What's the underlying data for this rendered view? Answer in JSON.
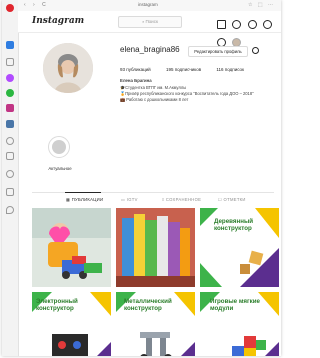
{
  "browser": {
    "nav_glyphs": "‹ › C",
    "url": "instagram",
    "actions_glyphs": "☆ ⬚ ⋯"
  },
  "header": {
    "logo": "Instagram",
    "search_placeholder": "Поиск"
  },
  "profile": {
    "username": "elena_bragina86",
    "edit_button": "Редактировать профиль",
    "stats": {
      "posts": "93 публикаций",
      "followers": "195 подписчиков",
      "following": "116 подписок"
    },
    "full_name": "Елена Брагина",
    "bio_lines": [
      "🎓Студентка ВТПГ им. М.Акмуллы",
      "🏅Призёр республиканского конкурса \"Воспитатель года ДОО – 2018\"",
      "💼 Работаю с дошкольниками 8 лет"
    ]
  },
  "highlights": [
    {
      "label": "Актуальное"
    }
  ],
  "tabs": {
    "posts": "ПУБЛИКАЦИИ",
    "igtv": "IGTV",
    "saved": "СОХРАНЕННОЕ",
    "tagged": "ОТМЕТКИ"
  },
  "tiles": [
    {
      "label": ""
    },
    {
      "label": ""
    },
    {
      "label": "Деревянный конструктор"
    },
    {
      "label": "Электронный конструктор"
    },
    {
      "label": "Металлический конструктор"
    },
    {
      "label": "Игровые мягкие модули"
    }
  ],
  "colors": {
    "accent_green": "#2a7d2a",
    "accent_purple": "#5b2e8f",
    "accent_yellow": "#f5c400"
  }
}
